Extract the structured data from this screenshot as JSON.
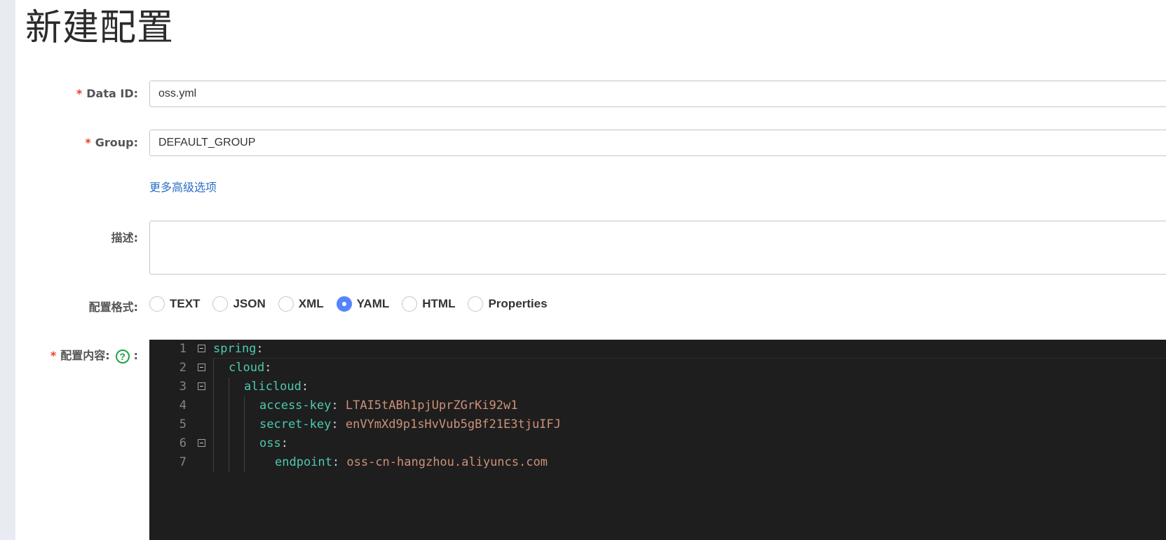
{
  "page": {
    "title": "新建配置"
  },
  "form": {
    "data_id": {
      "label": "Data ID:",
      "value": "oss.yml"
    },
    "group": {
      "label": "Group:",
      "value": "DEFAULT_GROUP"
    },
    "advanced_link": "更多高级选项",
    "description": {
      "label": "描述:",
      "value": ""
    },
    "format": {
      "label": "配置格式:",
      "options": [
        "TEXT",
        "JSON",
        "XML",
        "YAML",
        "HTML",
        "Properties"
      ],
      "selected": "YAML"
    },
    "content": {
      "label": "配置内容:",
      "help_glyph": "?",
      "colon": ":"
    },
    "required_mark": "*"
  },
  "editor": {
    "lines": [
      {
        "num": "1",
        "indent": 0,
        "key": "spring",
        "sep": ":",
        "value": "",
        "fold": true
      },
      {
        "num": "2",
        "indent": 1,
        "key": "cloud",
        "sep": ":",
        "value": "",
        "fold": true
      },
      {
        "num": "3",
        "indent": 2,
        "key": "alicloud",
        "sep": ":",
        "value": "",
        "fold": true
      },
      {
        "num": "4",
        "indent": 3,
        "key": "access-key",
        "sep": ": ",
        "value": "LTAI5tABh1pjUprZGrKi92w1",
        "fold": false
      },
      {
        "num": "5",
        "indent": 3,
        "key": "secret-key",
        "sep": ": ",
        "value": "enVYmXd9p1sHvVub5gBf21E3tjuIFJ",
        "fold": false
      },
      {
        "num": "6",
        "indent": 3,
        "key": "oss",
        "sep": ":",
        "value": "",
        "fold": true
      },
      {
        "num": "7",
        "indent": 4,
        "key": "endpoint",
        "sep": ": ",
        "value": "oss-cn-hangzhou.aliyuncs.com",
        "fold": false
      }
    ]
  },
  "colors": {
    "required": "#e8412c",
    "link": "#2f6ec7",
    "radio_checked": "#5584ff",
    "editor_bg": "#1e1e1e",
    "yaml_key": "#4ec9b0",
    "yaml_value": "#ce9178",
    "help_icon": "#1fa34a"
  }
}
